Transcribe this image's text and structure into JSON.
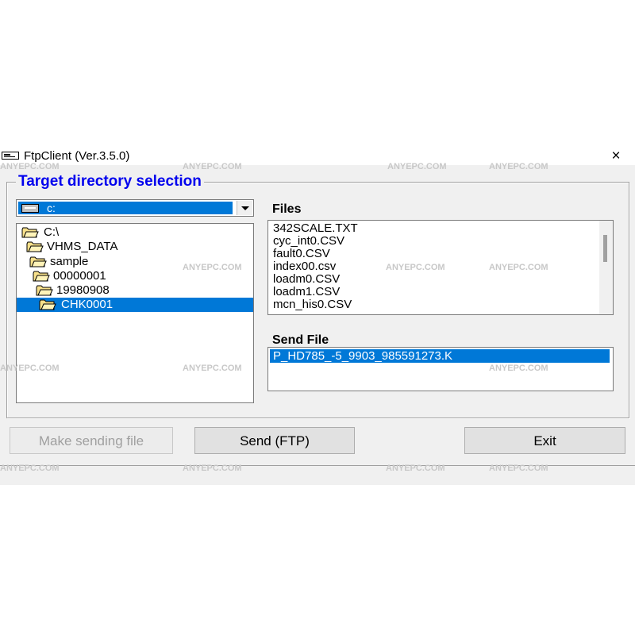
{
  "window": {
    "title": "FtpClient (Ver.3.5.0)",
    "close_label": "×"
  },
  "group": {
    "title": "Target directory selection"
  },
  "drive": {
    "selected": "c:"
  },
  "tree": {
    "items": [
      {
        "label": "C:\\",
        "selected": false
      },
      {
        "label": "VHMS_DATA",
        "selected": false
      },
      {
        "label": "sample",
        "selected": false
      },
      {
        "label": "00000001",
        "selected": false
      },
      {
        "label": "19980908",
        "selected": false
      },
      {
        "label": "CHK0001",
        "selected": true
      }
    ]
  },
  "files": {
    "label": "Files",
    "items": [
      "342SCALE.TXT",
      "cyc_int0.CSV",
      "fault0.CSV",
      "index00.csv",
      "loadm0.CSV",
      "loadm1.CSV",
      "mcn_his0.CSV"
    ]
  },
  "send_file": {
    "label": "Send File",
    "items": [
      "P_HD785_-5_9903_985591273.K"
    ]
  },
  "buttons": {
    "make_sending_file": "Make sending file",
    "send": "Send  (FTP)",
    "exit": "Exit"
  },
  "watermark": {
    "text": "ANYEPC.COM"
  },
  "colors": {
    "selection": "#0078d7",
    "title_blue": "#0000ee",
    "window_bg": "#f0f0f0"
  }
}
